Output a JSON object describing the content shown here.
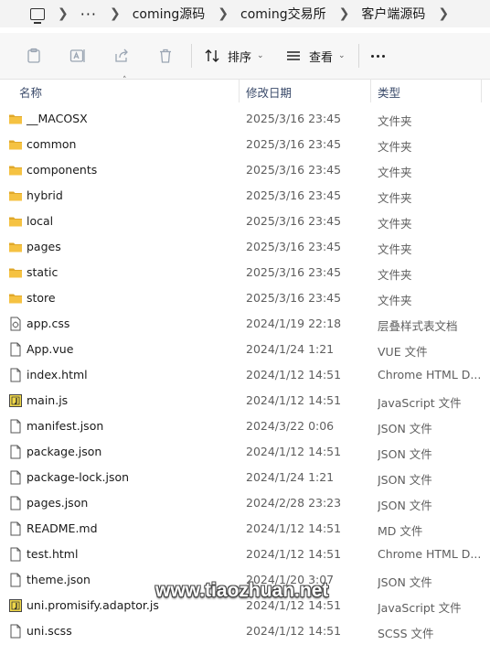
{
  "breadcrumb": {
    "more": "···",
    "segments": [
      "coming源码",
      "coming交易所",
      "客户端源码"
    ]
  },
  "toolbar": {
    "sort_label": "排序",
    "view_label": "查看"
  },
  "columns": {
    "name": "名称",
    "date": "修改日期",
    "type": "类型"
  },
  "rows": [
    {
      "name": "__MACOSX",
      "date": "2025/3/16 23:45",
      "type": "文件夹",
      "icon": "folder"
    },
    {
      "name": "common",
      "date": "2025/3/16 23:45",
      "type": "文件夹",
      "icon": "folder"
    },
    {
      "name": "components",
      "date": "2025/3/16 23:45",
      "type": "文件夹",
      "icon": "folder"
    },
    {
      "name": "hybrid",
      "date": "2025/3/16 23:45",
      "type": "文件夹",
      "icon": "folder"
    },
    {
      "name": "local",
      "date": "2025/3/16 23:45",
      "type": "文件夹",
      "icon": "folder"
    },
    {
      "name": "pages",
      "date": "2025/3/16 23:45",
      "type": "文件夹",
      "icon": "folder"
    },
    {
      "name": "static",
      "date": "2025/3/16 23:45",
      "type": "文件夹",
      "icon": "folder"
    },
    {
      "name": "store",
      "date": "2025/3/16 23:45",
      "type": "文件夹",
      "icon": "folder"
    },
    {
      "name": "app.css",
      "date": "2024/1/19 22:18",
      "type": "层叠样式表文档",
      "icon": "css"
    },
    {
      "name": "App.vue",
      "date": "2024/1/24 1:21",
      "type": "VUE 文件",
      "icon": "file"
    },
    {
      "name": "index.html",
      "date": "2024/1/12 14:51",
      "type": "Chrome HTML D...",
      "icon": "file"
    },
    {
      "name": "main.js",
      "date": "2024/1/12 14:51",
      "type": "JavaScript 文件",
      "icon": "js"
    },
    {
      "name": "manifest.json",
      "date": "2024/3/22 0:06",
      "type": "JSON 文件",
      "icon": "file"
    },
    {
      "name": "package.json",
      "date": "2024/1/12 14:51",
      "type": "JSON 文件",
      "icon": "file"
    },
    {
      "name": "package-lock.json",
      "date": "2024/1/24 1:21",
      "type": "JSON 文件",
      "icon": "file"
    },
    {
      "name": "pages.json",
      "date": "2024/2/28 23:23",
      "type": "JSON 文件",
      "icon": "file"
    },
    {
      "name": "README.md",
      "date": "2024/1/12 14:51",
      "type": "MD 文件",
      "icon": "file"
    },
    {
      "name": "test.html",
      "date": "2024/1/12 14:51",
      "type": "Chrome HTML D...",
      "icon": "file"
    },
    {
      "name": "theme.json",
      "date": "2024/1/20 3:07",
      "type": "JSON 文件",
      "icon": "file"
    },
    {
      "name": "uni.promisify.adaptor.js",
      "date": "2024/1/12 14:51",
      "type": "JavaScript 文件",
      "icon": "js"
    },
    {
      "name": "uni.scss",
      "date": "2024/1/12 14:51",
      "type": "SCSS 文件",
      "icon": "file"
    }
  ],
  "watermark": "www.tiaozhuan.net",
  "colors": {
    "folder": "#f5c242",
    "folder_dark": "#e0a82a",
    "js_badge": "#f0d84a"
  }
}
